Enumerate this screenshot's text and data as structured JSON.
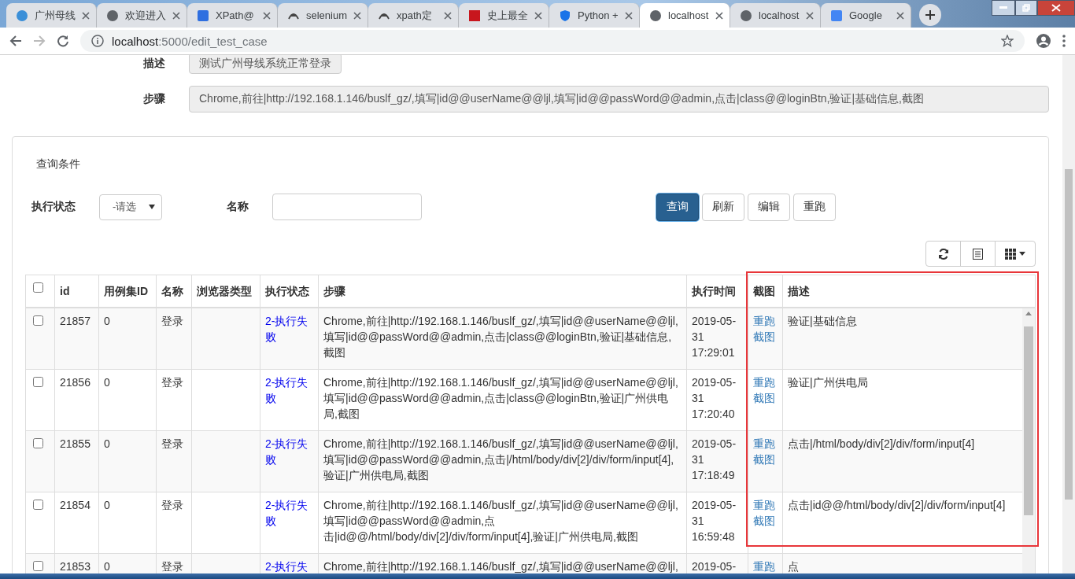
{
  "tabs": [
    {
      "label": "广州母线",
      "selected": false
    },
    {
      "label": "欢迎进入",
      "selected": false
    },
    {
      "label": "XPath@",
      "selected": false
    },
    {
      "label": "selenium",
      "selected": false
    },
    {
      "label": "xpath定",
      "selected": false
    },
    {
      "label": "史上最全",
      "selected": false
    },
    {
      "label": "Python +",
      "selected": false
    },
    {
      "label": "localhost",
      "selected": true
    },
    {
      "label": "localhost",
      "selected": false
    },
    {
      "label": "Google",
      "selected": false
    }
  ],
  "address_bar": {
    "host": "localhost",
    "path": ":5000/edit_test_case"
  },
  "form": [
    {
      "label": "描述",
      "value": "测试广州母线系统正常登录",
      "wide": false
    },
    {
      "label": "步骤",
      "value": "Chrome,前往|http://192.168.1.146/buslf_gz/,填写|id@@userName@@ljl,填写|id@@passWord@@admin,点击|class@@loginBtn,验证|基础信息,截图",
      "wide": true
    }
  ],
  "query": {
    "title": "查询条件",
    "status_label": "执行状态",
    "status_select": "-请选",
    "name_label": "名称",
    "buttons": [
      {
        "label": "查询",
        "primary": true
      },
      {
        "label": "刷新",
        "primary": false
      },
      {
        "label": "编辑",
        "primary": false
      },
      {
        "label": "重跑",
        "primary": false
      }
    ]
  },
  "table": {
    "select_all_checked": false,
    "columns": [
      "id",
      "用例集ID",
      "名称",
      "浏览器类型",
      "执行状态",
      "步骤",
      "执行时间",
      "截图",
      "描述"
    ],
    "rows": [
      {
        "checked": false,
        "id": "21857",
        "suite_id": "0",
        "name": "登录",
        "browser": "",
        "status": "2-执行失败",
        "steps": "Chrome,前往|http://192.168.1.146/buslf_gz/,填写|id@@userName@@ljl,填写|id@@passWord@@admin,点击|class@@loginBtn,验证|基础信息,截图",
        "time": "2019-05-31 17:29:01",
        "links": [
          "重跑",
          "截图"
        ],
        "description": "验证|基础信息"
      },
      {
        "checked": false,
        "id": "21856",
        "suite_id": "0",
        "name": "登录",
        "browser": "",
        "status": "2-执行失败",
        "steps": "Chrome,前往|http://192.168.1.146/buslf_gz/,填写|id@@userName@@ljl,填写|id@@passWord@@admin,点击|class@@loginBtn,验证|广州供电局,截图",
        "time": "2019-05-31 17:20:40",
        "links": [
          "重跑",
          "截图"
        ],
        "description": "验证|广州供电局"
      },
      {
        "checked": false,
        "id": "21855",
        "suite_id": "0",
        "name": "登录",
        "browser": "",
        "status": "2-执行失败",
        "steps": "Chrome,前往|http://192.168.1.146/buslf_gz/,填写|id@@userName@@ljl,填写|id@@passWord@@admin,点击|/html/body/div[2]/div/form/input[4],验证|广州供电局,截图",
        "time": "2019-05-31 17:18:49",
        "links": [
          "重跑",
          "截图"
        ],
        "description": "点击|/html/body/div[2]/div/form/input[4]"
      },
      {
        "checked": false,
        "id": "21854",
        "suite_id": "0",
        "name": "登录",
        "browser": "",
        "status": "2-执行失败",
        "steps": "Chrome,前往|http://192.168.1.146/buslf_gz/,填写|id@@userName@@ljl,填写|id@@passWord@@admin,点击|id@@/html/body/div[2]/div/form/input[4],验证|广州供电局,截图",
        "time": "2019-05-31 16:59:48",
        "links": [
          "重跑",
          "截图"
        ],
        "description": "点击|id@@/html/body/div[2]/div/form/input[4]"
      },
      {
        "checked": false,
        "id": "21853",
        "suite_id": "0",
        "name": "登录",
        "browser": "",
        "status": "2-执行失",
        "steps": "Chrome,前往|http://192.168.1.146/buslf_gz/,填写|id@@userName@@ljl,",
        "time": "2019-05-",
        "links": [
          "重跑"
        ],
        "description": "点"
      }
    ]
  }
}
